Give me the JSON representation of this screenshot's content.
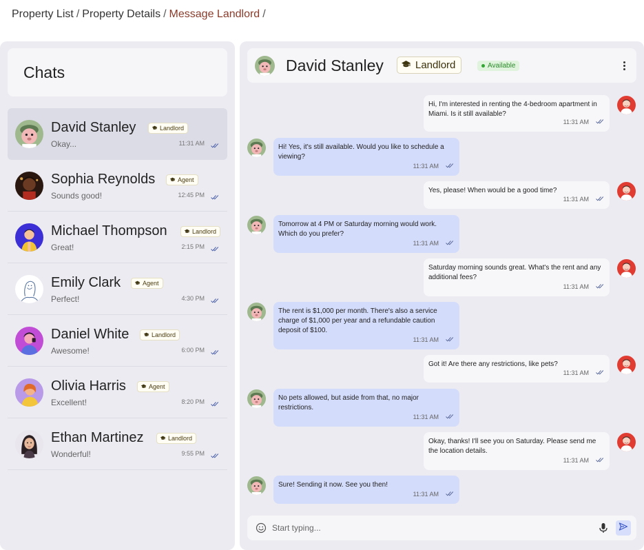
{
  "breadcrumb": {
    "items": [
      "Property List",
      "Property Details",
      "Message Landlord"
    ],
    "separator": "/"
  },
  "sidebar": {
    "title": "Chats",
    "chats": [
      {
        "name": "David Stanley",
        "role": "Landlord",
        "preview": "Okay...",
        "time": "11:31 AM",
        "avatar": "pink-character",
        "selected": true
      },
      {
        "name": "Sophia Reynolds",
        "role": "Agent",
        "preview": "Sounds good!",
        "time": "12:45 PM",
        "avatar": "dark-portrait"
      },
      {
        "name": "Michael Thompson",
        "role": "Landlord",
        "preview": "Great!",
        "time": "2:15 PM",
        "avatar": "blue-character"
      },
      {
        "name": "Emily Clark",
        "role": "Agent",
        "preview": "Perfect!",
        "time": "4:30 PM",
        "avatar": "line-drawing"
      },
      {
        "name": "Daniel White",
        "role": "Landlord",
        "preview": "Awesome!",
        "time": "6:00 PM",
        "avatar": "purple-character"
      },
      {
        "name": "Olivia Harris",
        "role": "Agent",
        "preview": "Excellent!",
        "time": "8:20 PM",
        "avatar": "lilac-character"
      },
      {
        "name": "Ethan Martinez",
        "role": "Landlord",
        "preview": "Wonderful!",
        "time": "9:55 PM",
        "avatar": "woman-portrait"
      }
    ]
  },
  "conversation": {
    "name": "David Stanley",
    "role": "Landlord",
    "status": "Available",
    "messages": [
      {
        "direction": "out",
        "text": "Hi, I'm interested in renting the 4-bedroom apartment in Miami. Is it still available?",
        "time": "11:31 AM"
      },
      {
        "direction": "in",
        "text": "Hi! Yes, it's still available. Would you like to schedule a viewing?",
        "time": "11:31 AM"
      },
      {
        "direction": "out",
        "text": "Yes, please! When would be a good time?",
        "time": "11:31 AM"
      },
      {
        "direction": "in",
        "text": "Tomorrow at 4 PM or Saturday morning would work. Which do you prefer?",
        "time": "11:31 AM"
      },
      {
        "direction": "out",
        "text": "Saturday morning sounds great. What's the rent and any additional fees?",
        "time": "11:31 AM"
      },
      {
        "direction": "in",
        "text": "The rent is $1,000 per month. There's also a service charge of $1,000 per year and a refundable caution deposit of $100.",
        "time": "11:31 AM"
      },
      {
        "direction": "out",
        "text": "Got it! Are there any restrictions, like pets?",
        "time": "11:31 AM"
      },
      {
        "direction": "in",
        "text": "No pets allowed, but aside from that, no major restrictions.",
        "time": "11:31 AM"
      },
      {
        "direction": "out",
        "text": "Okay, thanks! I'll see you on Saturday. Please send me the location details.",
        "time": "11:31 AM"
      },
      {
        "direction": "in",
        "text": "Sure! Sending it now. See you then!",
        "time": "11:31 AM"
      }
    ]
  },
  "input": {
    "placeholder": "Start typing...",
    "value": ""
  },
  "icons": {
    "emoji": "smiley-icon",
    "mic": "microphone-icon",
    "send": "send-icon",
    "more": "more-vertical-icon",
    "role": "graduation-cap-icon",
    "read": "double-check-icon"
  },
  "colors": {
    "breadcrumb_active": "#8a3b2a",
    "incoming_bubble": "#d4dcfb",
    "outgoing_bubble": "#f7f7fa",
    "status_green": "#2c8a2c",
    "panel_bg": "#ebebf1"
  }
}
